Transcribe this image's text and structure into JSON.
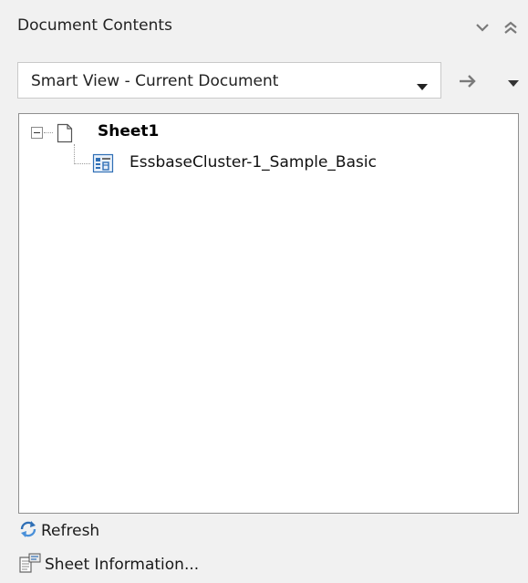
{
  "header": {
    "title": "Document Contents"
  },
  "connection": {
    "selected": "Smart View - Current Document"
  },
  "tree": {
    "sheet": {
      "label": "Sheet1",
      "expanded": true,
      "children": [
        {
          "label": "EssbaseCluster-1_Sample_Basic",
          "icon": "database-connection-icon"
        }
      ]
    }
  },
  "actions": {
    "refresh": "Refresh",
    "sheet_info": "Sheet Information..."
  },
  "colors": {
    "panel_bg": "#f1f1f1",
    "tree_border": "#8f8f8f",
    "icon_blue": "#2f6fb5"
  }
}
